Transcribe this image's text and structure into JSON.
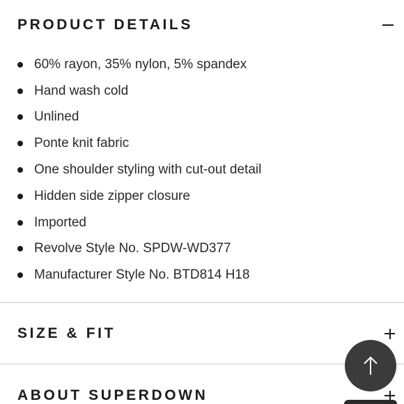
{
  "product_details": {
    "title": "PRODUCT DETAILS",
    "toggle": "collapse",
    "items": [
      "60% rayon, 35% nylon, 5% spandex",
      "Hand wash cold",
      "Unlined",
      "Ponte knit fabric",
      "One shoulder styling with cut-out detail",
      "Hidden side zipper closure",
      "Imported",
      "Revolve Style No. SPDW-WD377",
      "Manufacturer Style No. BTD814 H18"
    ]
  },
  "size_fit": {
    "title": "SIZE & FIT",
    "toggle": "expand"
  },
  "about": {
    "title": "ABOUT SUPERDOWN",
    "toggle": "expand"
  },
  "icons": {
    "scroll_top": "arrow-up-icon",
    "minus": "minus-icon",
    "plus": "plus-icon"
  },
  "colors": {
    "text": "#1c1c1c",
    "divider": "#c9c9c9",
    "scroll_button": "#3b3b3b"
  }
}
